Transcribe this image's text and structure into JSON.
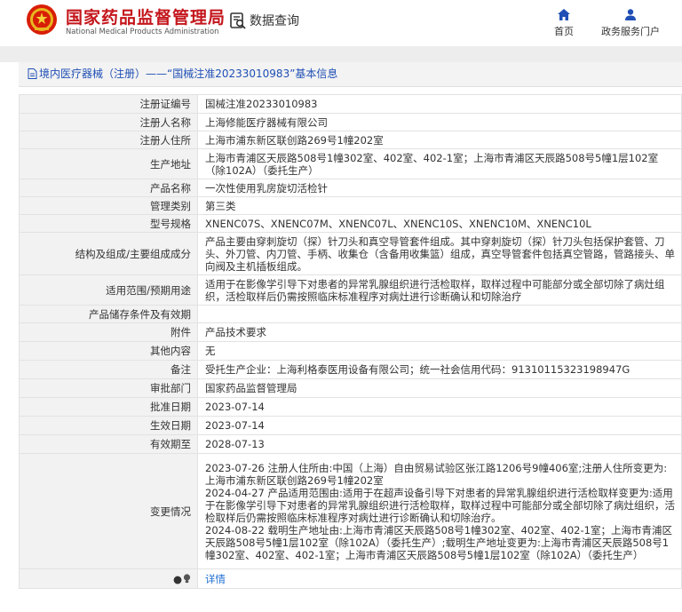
{
  "site": {
    "name_cn": "国家药品监督管理局",
    "name_en": "National Medical Products Administration"
  },
  "header": {
    "data_query": "数据查询",
    "nav_home": "首页",
    "nav_gov_service": "政务服务门户"
  },
  "panel": {
    "title": "境内医疗器械（注册）——“国械注准20233010983”基本信息"
  },
  "rows": [
    {
      "label": "注册证编号",
      "value": "国械注准20233010983"
    },
    {
      "label": "注册人名称",
      "value": "上海修能医疗器械有限公司"
    },
    {
      "label": "注册人住所",
      "value": "上海市浦东新区联创路269号1幢202室"
    },
    {
      "label": "生产地址",
      "value": "上海市青浦区天辰路508号1幢302室、402室、402-1室；上海市青浦区天辰路508号5幢1层102室（除102A）（委托生产）"
    },
    {
      "label": "产品名称",
      "value": "一次性使用乳房旋切活检针"
    },
    {
      "label": "管理类别",
      "value": "第三类"
    },
    {
      "label": "型号规格",
      "value": "XNENC07S、XNENC07M、XNENC07L、XNENC10S、XNENC10M、XNENC10L"
    },
    {
      "label": "结构及组成/主要组成成分",
      "value": "产品主要由穿刺旋切（探）针刀头和真空导管套件组成。其中穿刺旋切（探）针刀头包括保护套管、刀头、外刀管、内刀管、手柄、收集仓（含备用收集篮）组成，真空导管套件包括真空管路，管路接头、单向阀及主机插板组成。"
    },
    {
      "label": "适用范围/预期用途",
      "value": "适用于在影像学引导下对患者的异常乳腺组织进行活检取样，取样过程中可能部分或全部切除了病灶组织，活检取样后仍需按照临床标准程序对病灶进行诊断确认和切除治疗"
    },
    {
      "label": "产品储存条件及有效期",
      "value": ""
    },
    {
      "label": "附件",
      "value": "产品技术要求"
    },
    {
      "label": "其他内容",
      "value": "无"
    },
    {
      "label": "备注",
      "value": "受托生产企业：上海利格泰医用设备有限公司；统一社会信用代码：91310115323198947G"
    },
    {
      "label": "审批部门",
      "value": "国家药品监督管理局"
    },
    {
      "label": "批准日期",
      "value": "2023-07-14"
    },
    {
      "label": "生效日期",
      "value": "2023-07-14"
    },
    {
      "label": "有效期至",
      "value": "2028-07-13"
    }
  ],
  "changes": {
    "label": "变更情况",
    "entries": [
      "2023-07-26 注册人住所由:中国（上海）自由贸易试验区张江路1206号9幢406室;注册人住所变更为:上海市浦东新区联创路269号1幢202室",
      "2024-04-27 产品适用范围由:适用于在超声设备引导下对患者的异常乳腺组织进行活检取样变更为:适用于在影像学引导下对患者的异常乳腺组织进行活检取样，取样过程中可能部分或全部切除了病灶组织，活检取样后仍需按照临床标准程序对病灶进行诊断确认和切除治疗。",
      "2024-08-22 载明生产地址由:上海市青浦区天辰路508号1幢302室、402室、402-1室；上海市青浦区天辰路508号5幢1层102室（除102A）（委托生产）;载明生产地址变更为:上海市青浦区天辰路508号1幢302室、402室、402-1室；上海市青浦区天辰路508号5幢1层102室（除102A）（委托生产）"
    ]
  },
  "footer_row": {
    "label": "●",
    "link": "详情"
  },
  "colors": {
    "brand_red": "#c4161c",
    "link_blue": "#1f6fd1",
    "title_blue": "#1f4fb5"
  },
  "icons": [
    "emblem-icon",
    "data-query-icon",
    "home-icon",
    "person-icon",
    "document-icon",
    "bulb-icon"
  ]
}
